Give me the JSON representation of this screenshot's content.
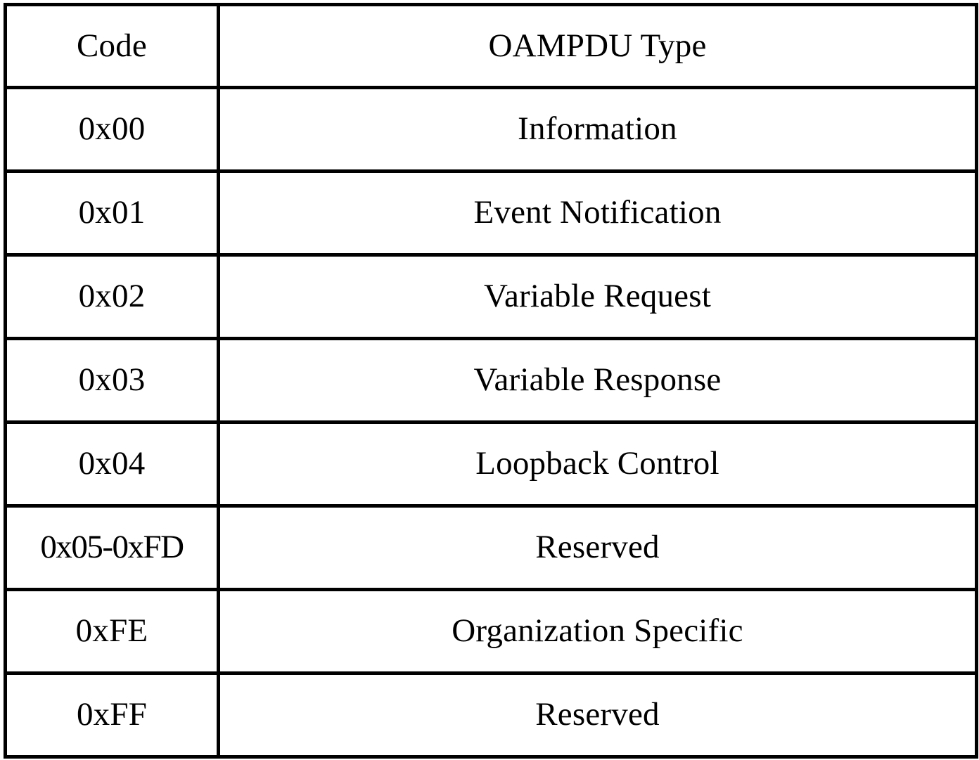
{
  "table": {
    "columns": [
      {
        "key": "code",
        "header": "Code"
      },
      {
        "key": "type",
        "header": "OAMPDU Type"
      }
    ],
    "rows": [
      {
        "code": "0x00",
        "type": "Information"
      },
      {
        "code": "0x01",
        "type": "Event Notification"
      },
      {
        "code": "0x02",
        "type": "Variable Request"
      },
      {
        "code": "0x03",
        "type": "Variable Response"
      },
      {
        "code": "0x04",
        "type": "Loopback Control"
      },
      {
        "code": "0x05-0xFD",
        "type": "Reserved"
      },
      {
        "code": "0xFE",
        "type": "Organization Specific"
      },
      {
        "code": "0xFF",
        "type": "Reserved"
      }
    ]
  },
  "style": {
    "border_color": "#000000",
    "background_color": "#ffffff",
    "text_color": "#000000"
  }
}
